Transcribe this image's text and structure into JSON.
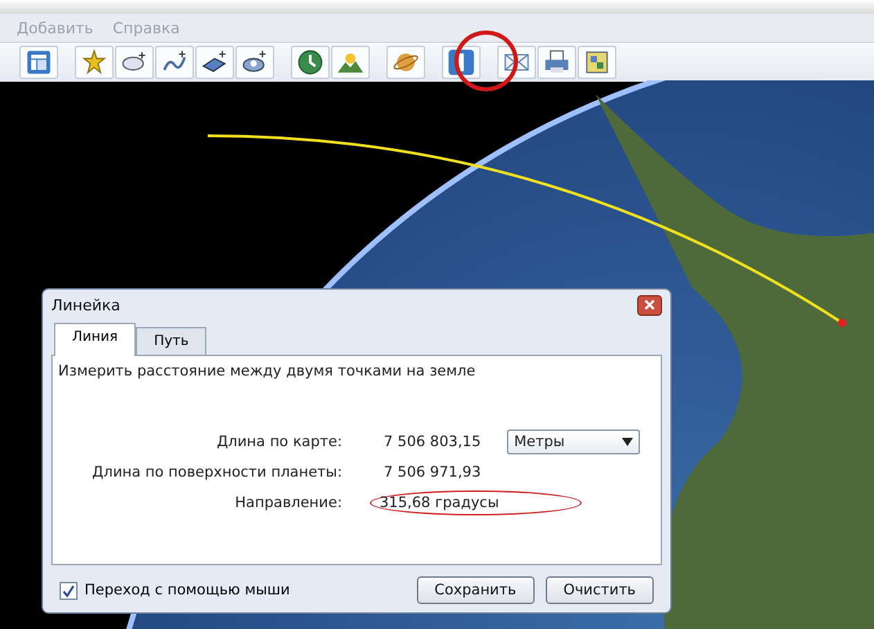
{
  "menu": [
    {
      "label": "Добавить",
      "disabled": true
    },
    {
      "label": "Справка",
      "disabled": true
    }
  ],
  "dialog": {
    "title": "Линейка",
    "tabs": [
      {
        "label": "Линия",
        "selected": true
      },
      {
        "label": "Путь",
        "selected": false
      }
    ],
    "description": "Измерить расстояние между двумя точками на земле",
    "rows": [
      {
        "label": "Длина по карте:",
        "value": "7 506 803,15",
        "circled": false
      },
      {
        "label": "Длина по поверхности планеты:",
        "value": "7 506 971,93",
        "circled": false
      },
      {
        "label": "Направление:",
        "value": "315,68 градусы",
        "circled": true
      }
    ],
    "unit": "Метры",
    "fly_checkbox": {
      "label": "Переход с помощью мыши",
      "checked": true
    },
    "buttons": [
      "Сохранить",
      "Очистить"
    ]
  }
}
